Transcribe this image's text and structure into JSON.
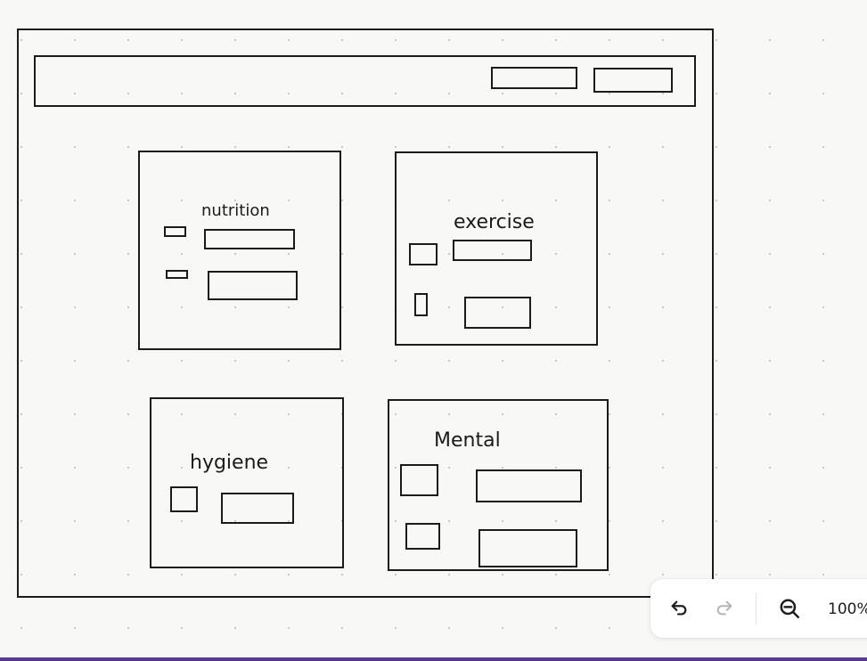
{
  "canvas": {
    "labels": {
      "nutrition": "nutrition",
      "exercise": "exercise",
      "hygiene": "hygiene",
      "mental": "Mental"
    }
  },
  "toolbar": {
    "undo_icon": "undo-icon",
    "redo_icon": "redo-icon",
    "zoom_out_icon": "zoom-out-icon",
    "zoom_level": "100%"
  },
  "colors": {
    "canvas_background": "#f8f8f6",
    "stroke": "#1b1b1b",
    "grid_dot": "#c6c6c4",
    "toolbar_background": "#ffffff",
    "icon_active": "#1e1e1e",
    "icon_disabled": "#b5b5b5",
    "bottom_bar": "#5a3a8c"
  }
}
